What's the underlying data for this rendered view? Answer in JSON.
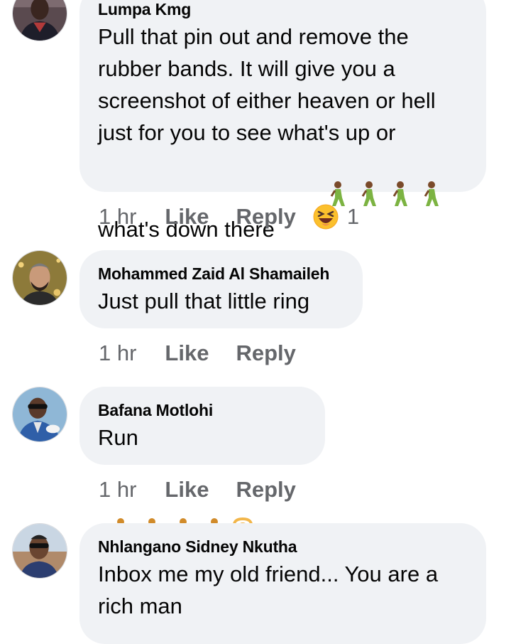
{
  "comments": [
    {
      "author": "Lumpa Kmg",
      "text": "Pull that pin out and remove the\nrubber bands. It will give you a\nscreenshot of either heaven or hell\njust for you to see what's up or\nwhat's down there",
      "emoji_icons": [
        "person-walking-icon",
        "person-walking-icon",
        "person-walking-icon",
        "person-walking-icon"
      ],
      "time": "1 hr",
      "like": "Like",
      "reply": "Reply",
      "reaction_icon": "laughing-squint-face-icon",
      "reaction_count": "1"
    },
    {
      "author": "Mohammed Zaid Al Shamaileh",
      "text": "Just pull that little ring",
      "time": "1 hr",
      "like": "Like",
      "reply": "Reply"
    },
    {
      "author": "Bafana Motlohi",
      "text": "Run",
      "emoji_icons": [
        "person-running-icon",
        "person-running-icon",
        "person-running-icon",
        "person-running-icon",
        "person-gesturing-ok-icon"
      ],
      "time": "1 hr",
      "like": "Like",
      "reply": "Reply"
    },
    {
      "author": "Nhlangano Sidney Nkutha",
      "text": "Inbox me my old friend... You are a\nrich man"
    }
  ],
  "colors": {
    "bubble": "#f0f2f5",
    "meta_text": "#65676b",
    "body_text": "#050505"
  }
}
